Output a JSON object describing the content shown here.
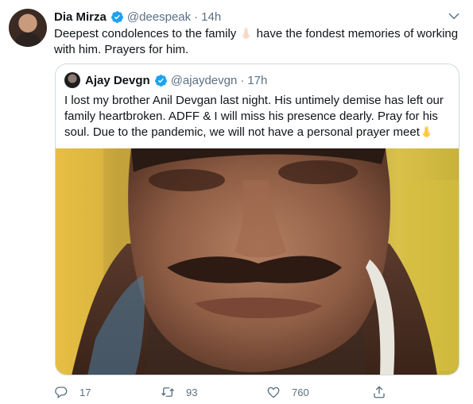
{
  "tweet": {
    "author_name": "Dia Mirza",
    "author_handle": "@deespeak",
    "separator": "·",
    "time": "14h",
    "text_part1": "Deepest condolences to the family ",
    "text_part2": " have the fondest memories of working with him. Prayers for him.",
    "emoji_in_text": "folded-hands-emoji"
  },
  "quoted_tweet": {
    "author_name": "Ajay Devgn",
    "author_handle": "@ajaydevgn",
    "separator": "·",
    "time": "17h",
    "text": "I lost my brother Anil Devgan last night. His untimely demise has left our family heartbroken. ADFF & I will miss his presence dearly. Pray for his soul. Due to the pandemic, we will not have a personal prayer meet",
    "emoji_in_text": "folded-hands-emoji"
  },
  "actions": {
    "reply_count": "17",
    "retweet_count": "93",
    "like_count": "760"
  },
  "icons": [
    "verified-badge-icon",
    "caret-down-icon",
    "reply-icon",
    "retweet-icon",
    "like-icon",
    "share-icon"
  ],
  "colors": {
    "accent": "#1da1f2",
    "secondary_text": "#5b7083",
    "border": "#cfd9de"
  }
}
